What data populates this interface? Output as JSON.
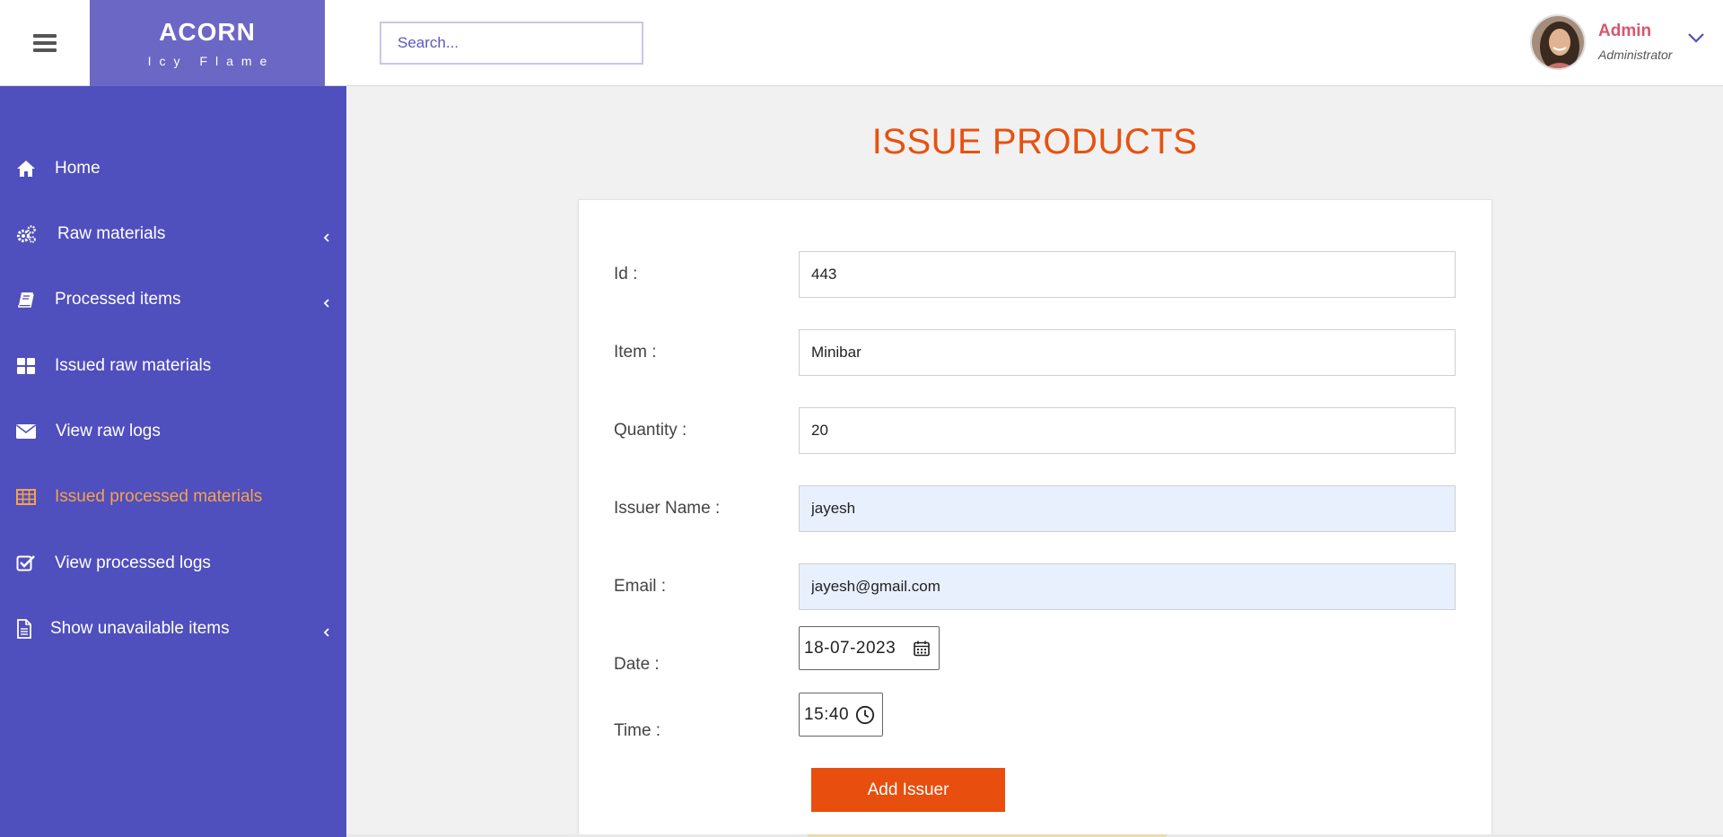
{
  "header": {
    "brand_name": "ACORN",
    "brand_tagline": "Icy Flame",
    "search_placeholder": "Search...",
    "user_name": "Admin",
    "user_role": "Administrator"
  },
  "sidebar": {
    "items": [
      {
        "label": "Home",
        "icon": "home-icon",
        "has_submenu": false
      },
      {
        "label": "Raw materials",
        "icon": "gears-icon",
        "has_submenu": true
      },
      {
        "label": "Processed items",
        "icon": "book-icon",
        "has_submenu": true
      },
      {
        "label": "Issued raw materials",
        "icon": "grid-icon",
        "has_submenu": false
      },
      {
        "label": "View raw logs",
        "icon": "envelope-icon",
        "has_submenu": false
      },
      {
        "label": "Issued processed materials",
        "icon": "table-icon",
        "has_submenu": false,
        "active": true
      },
      {
        "label": "View processed logs",
        "icon": "checkbox-icon",
        "has_submenu": false
      },
      {
        "label": "Show unavailable items",
        "icon": "file-icon",
        "has_submenu": true
      }
    ]
  },
  "main": {
    "title": "ISSUE PRODUCTS",
    "form": {
      "id_label": "Id :",
      "id_value": "443",
      "item_label": "Item :",
      "item_value": "Minibar",
      "quantity_label": "Quantity :",
      "quantity_value": "20",
      "issuer_label": "Issuer Name :",
      "issuer_value": "jayesh",
      "email_label": "Email :",
      "email_value": "jayesh@gmail.com",
      "date_label": "Date :",
      "date_value": "18-07-2023",
      "time_label": "Time :",
      "time_value": "15:40",
      "submit_label": "Add Issuer"
    }
  },
  "colors": {
    "sidebar_bg": "#4f4fbd",
    "brand_bg": "#6b67c4",
    "accent_orange": "#e84e0e",
    "active_nav": "#f5a24d",
    "user_name": "#d8566c"
  }
}
